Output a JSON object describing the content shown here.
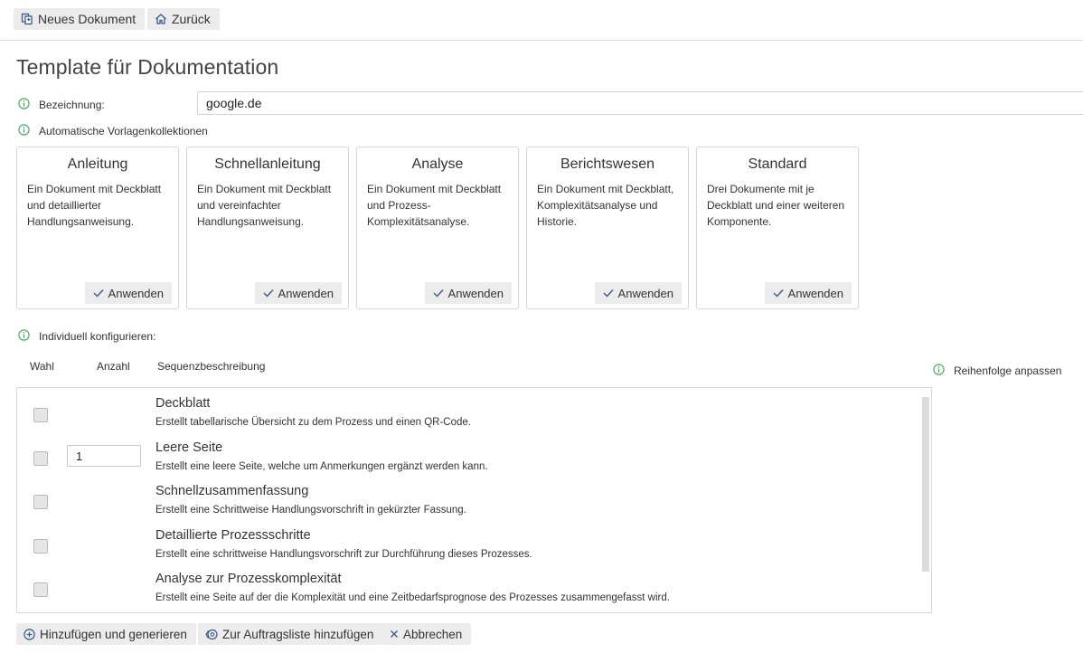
{
  "toolbar": {
    "new_document": "Neues Dokument",
    "back": "Zurück"
  },
  "page": {
    "title": "Template für Dokumentation"
  },
  "designation": {
    "label": "Bezeichnung:",
    "value": "google.de"
  },
  "auto_collections": {
    "label": "Automatische Vorlagenkollektionen",
    "cards": [
      {
        "title": "Anleitung",
        "description": "Ein Dokument mit Deckblatt und detaillierter Handlungsanweisung.",
        "apply": "Anwenden"
      },
      {
        "title": "Schnellanleitung",
        "description": "Ein Dokument mit Deckblatt und vereinfachter Handlungsanweisung.",
        "apply": "Anwenden"
      },
      {
        "title": "Analyse",
        "description": "Ein Dokument mit Deckblatt und Prozess-Komplexitätsanalyse.",
        "apply": "Anwenden"
      },
      {
        "title": "Berichtswesen",
        "description": "Ein Dokument mit Deckblatt, Komplexitätsanalyse und Historie.",
        "apply": "Anwenden"
      },
      {
        "title": "Standard",
        "description": "Drei Dokumente mit je Deckblatt und einer weiteren Komponente.",
        "apply": "Anwenden"
      }
    ]
  },
  "individual": {
    "label": "Individuell konfigurieren:",
    "columns": {
      "choice": "Wahl",
      "count": "Anzahl",
      "sequence": "Sequenzbeschreibung"
    },
    "reorder": "Reihenfolge anpassen",
    "rows": [
      {
        "title": "Deckblatt",
        "description": "Erstellt tabellarische Übersicht zu dem Prozess und einen QR-Code.",
        "count": ""
      },
      {
        "title": "Leere Seite",
        "description": "Erstellt eine leere Seite, welche um Anmerkungen ergänzt werden kann.",
        "count": "1"
      },
      {
        "title": "Schnellzusammenfassung",
        "description": "Erstellt eine Schrittweise Handlungsvorschrift in gekürzter Fassung.",
        "count": ""
      },
      {
        "title": "Detaillierte Prozessschritte",
        "description": "Erstellt eine schrittweise Handlungsvorschrift zur Durchführung dieses Prozesses.",
        "count": ""
      },
      {
        "title": "Analyse zur Prozesskomplexität",
        "description": "Erstellt eine Seite auf der die Komplexität und eine Zeitbedarfsprognose des Prozesses zusammengefasst wird.",
        "count": ""
      }
    ]
  },
  "actions": {
    "add_generate": "Hinzufügen und generieren",
    "add_queue": "Zur Auftragsliste hinzufügen",
    "cancel": "Abbrechen"
  },
  "colors": {
    "info_icon": "#3aa757",
    "button_bg": "#ececec",
    "button_icon": "#3b5a8c"
  }
}
